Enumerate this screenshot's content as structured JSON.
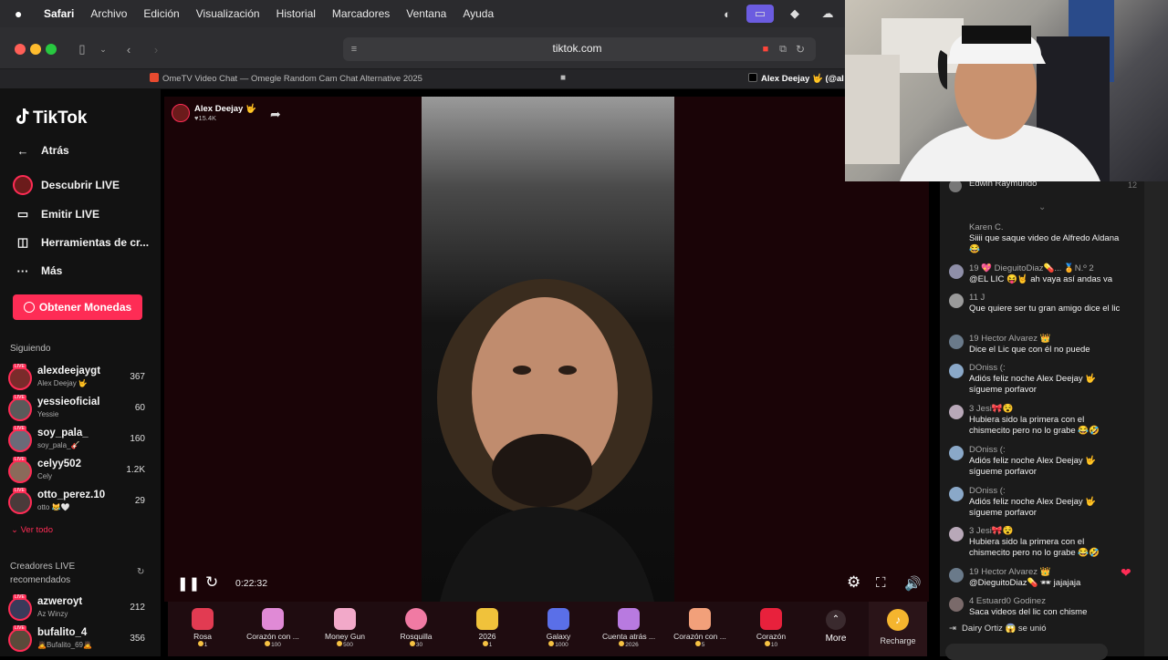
{
  "menubar": {
    "app": "Safari",
    "items": [
      "Archivo",
      "Edición",
      "Visualización",
      "Historial",
      "Marcadores",
      "Ventana",
      "Ayuda"
    ]
  },
  "browser": {
    "url": "tiktok.com",
    "tabs": [
      {
        "label": "OmeTV Video Chat — Omegle Random Cam Chat Alternative 2025"
      },
      {
        "label": "Alex Deejay 🤟 (@al"
      }
    ]
  },
  "sidebar": {
    "logo": "TikTok",
    "nav": [
      {
        "label": "Atrás",
        "icon": "back-arrow-icon"
      },
      {
        "label": "Descubrir LIVE",
        "icon": "live-avatar-icon"
      },
      {
        "label": "Emitir LIVE",
        "icon": "video-camera-icon"
      },
      {
        "label": "Herramientas de cr...",
        "icon": "creator-tools-icon"
      },
      {
        "label": "Más",
        "icon": "more-dots-icon"
      }
    ],
    "coins_button": "Obtener Monedas",
    "following_title": "Siguiendo",
    "following": [
      {
        "name": "alexdeejaygt",
        "sub": "Alex Deejay 🤟",
        "count": "367"
      },
      {
        "name": "yessieoficial",
        "sub": "Yessie",
        "count": "60"
      },
      {
        "name": "soy_pala_",
        "sub": "soy_pala_🎸",
        "count": "160"
      },
      {
        "name": "celyy502",
        "sub": "Cely",
        "count": "1.2K"
      },
      {
        "name": "otto_perez.10",
        "sub": "otto 😹🤍",
        "count": "29"
      }
    ],
    "see_all": "Ver todo",
    "recommended_title_1": "Creadores LIVE",
    "recommended_title_2": "recomendados",
    "recommended": [
      {
        "name": "azweroyt",
        "sub": "Az Winzy",
        "count": "212"
      },
      {
        "name": "bufalito_4",
        "sub": "🙇Bufalito_69🙇",
        "count": "356"
      }
    ]
  },
  "stream": {
    "host_name": "Alex Deejay 🤟",
    "host_likes": "♥15.4K",
    "elapsed": "0:22:32"
  },
  "gifts": [
    {
      "name": "Rosa",
      "price": "1",
      "color": "#e23b52"
    },
    {
      "name": "Corazón con ...",
      "price": "100",
      "color": "#e08ad6"
    },
    {
      "name": "Money Gun",
      "price": "500",
      "color": "#f2a9c9"
    },
    {
      "name": "Rosquilla",
      "price": "30",
      "color": "#f07aa3"
    },
    {
      "name": "2026",
      "price": "1",
      "color": "#f0c23b"
    },
    {
      "name": "Galaxy",
      "price": "1000",
      "color": "#5a6fe8"
    },
    {
      "name": "Cuenta atrás ...",
      "price": "2026",
      "color": "#b87ae0"
    },
    {
      "name": "Corazón con ...",
      "price": "5",
      "color": "#f2a07a"
    },
    {
      "name": "Corazón",
      "price": "10",
      "color": "#e8213c"
    }
  ],
  "gift_more": "More",
  "recharge": "Recharge",
  "chat": [
    {
      "head": "Edwin Raymundo",
      "body": ""
    },
    {
      "head": "Karen C.",
      "body": "Siiii que saque video de Alfredo Aldana 😂"
    },
    {
      "head": "19 💖 DieguitoDiaz💊... 🏅N.º 2",
      "body": "@EL LIC 😝🤘 ah vaya así andas va"
    },
    {
      "head": "11 J",
      "body": "Que quiere ser tu gran amigo dice el lic"
    },
    {
      "head": "19 Hector Alvarez 👑",
      "body": "Dice el Lic que con él no puede"
    },
    {
      "head": "DOniss (:",
      "body": "Adiós feliz noche Alex Deejay 🤟 sígueme porfavor"
    },
    {
      "head": "3 Jesi🎀😵",
      "body": "Hubiera sido la primera con el chismecito pero no lo grabe 😂🤣"
    },
    {
      "head": "DOniss (:",
      "body": "Adiós feliz noche Alex Deejay 🤟 sígueme porfavor"
    },
    {
      "head": "DOniss (:",
      "body": "Adiós feliz noche Alex Deejay 🤟 sígueme porfavor"
    },
    {
      "head": "3 Jesi🎀😵",
      "body": "Hubiera sido la primera con el chismecito pero no lo grabe 😂🤣"
    },
    {
      "head": "19 Hector Alvarez 👑",
      "body": "@DieguitoDiaz💊 🕶 jajajaja"
    },
    {
      "head": "4 Estuard0 Godinez",
      "body": "Saca videos del lic con chisme"
    }
  ],
  "chat_join": "Dairy Ortiz 😱 se unió",
  "chat_top_count": "12",
  "accent": "#fe2c55"
}
